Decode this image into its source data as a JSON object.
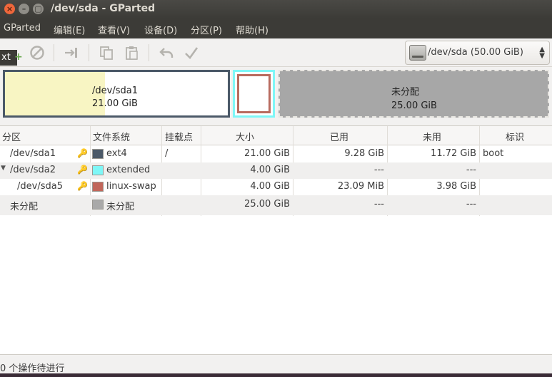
{
  "window": {
    "title": "/dev/sda - GParted",
    "close_glyph": "×",
    "min_glyph": "–",
    "max_glyph": "▢"
  },
  "menu": [
    "GParted",
    "编辑(E)",
    "查看(V)",
    "设备(D)",
    "分区(P)",
    "帮助(H)"
  ],
  "toolbar": {
    "tooltip_fragment": "xt",
    "device_selector": "/dev/sda  (50.00 GiB)"
  },
  "diskmap": {
    "sda1": {
      "name": "/dev/sda1",
      "size": "21.00 GiB"
    },
    "unallocated": {
      "name": "未分配",
      "size": "25.00 GiB"
    }
  },
  "table": {
    "headers": [
      "分区",
      "文件系统",
      "挂载点",
      "大小",
      "已用",
      "未用",
      "标识"
    ],
    "rows": [
      {
        "partition": "/dev/sda1",
        "filesystem": "ext4",
        "mount": "/",
        "size": "21.00 GiB",
        "used": "9.28 GiB",
        "unused": "11.72 GiB",
        "flags": "boot",
        "color": "#4b5968"
      },
      {
        "partition": "/dev/sda2",
        "filesystem": "extended",
        "mount": "",
        "size": "4.00 GiB",
        "used": "---",
        "unused": "---",
        "flags": "",
        "color": "#7ef7f7"
      },
      {
        "partition": "/dev/sda5",
        "filesystem": "linux-swap",
        "mount": "",
        "size": "4.00 GiB",
        "used": "23.09 MiB",
        "unused": "3.98 GiB",
        "flags": "",
        "color": "#c1665a"
      },
      {
        "partition": "未分配",
        "filesystem": "未分配",
        "mount": "",
        "size": "25.00 GiB",
        "used": "---",
        "unused": "---",
        "flags": "",
        "color": "#a9a9a9"
      }
    ]
  },
  "status": "0 个操作待进行"
}
